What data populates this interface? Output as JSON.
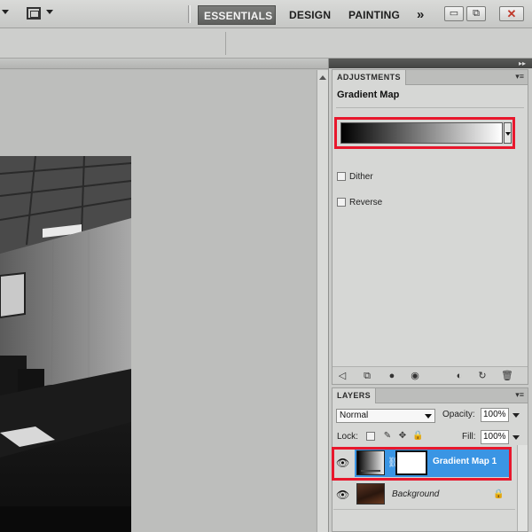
{
  "toolbar": {
    "workspaces": {
      "essentials": "ESSENTIALS",
      "design": "DESIGN",
      "painting": "PAINTING",
      "more": "»"
    },
    "window_controls": {
      "minimize": "▭",
      "restore": "⧉",
      "close": "✕"
    }
  },
  "adjustments": {
    "tab": "ADJUSTMENTS",
    "menu": "▾≡",
    "title": "Gradient Map",
    "gradient": {
      "start_color": "#000000",
      "end_color": "#ffffff"
    },
    "dither_label": "Dither",
    "dither_checked": false,
    "reverse_label": "Reverse",
    "reverse_checked": false,
    "footer_icons": [
      "back-arrow-icon",
      "clip-icon",
      "visibility-toggle-icon",
      "eye-icon",
      "view-previous-icon",
      "reset-icon",
      "trash-icon"
    ]
  },
  "layers": {
    "tab": "LAYERS",
    "menu": "▾≡",
    "blend_mode": "Normal",
    "opacity_label": "Opacity:",
    "opacity_value": "100%",
    "lock_label": "Lock:",
    "fill_label": "Fill:",
    "fill_value": "100%",
    "items": [
      {
        "name": "Gradient Map 1",
        "selected": true
      },
      {
        "name": "Background",
        "locked": true
      }
    ]
  },
  "colors": {
    "accent_highlight": "#e8172c",
    "selection": "#3a95e4"
  }
}
